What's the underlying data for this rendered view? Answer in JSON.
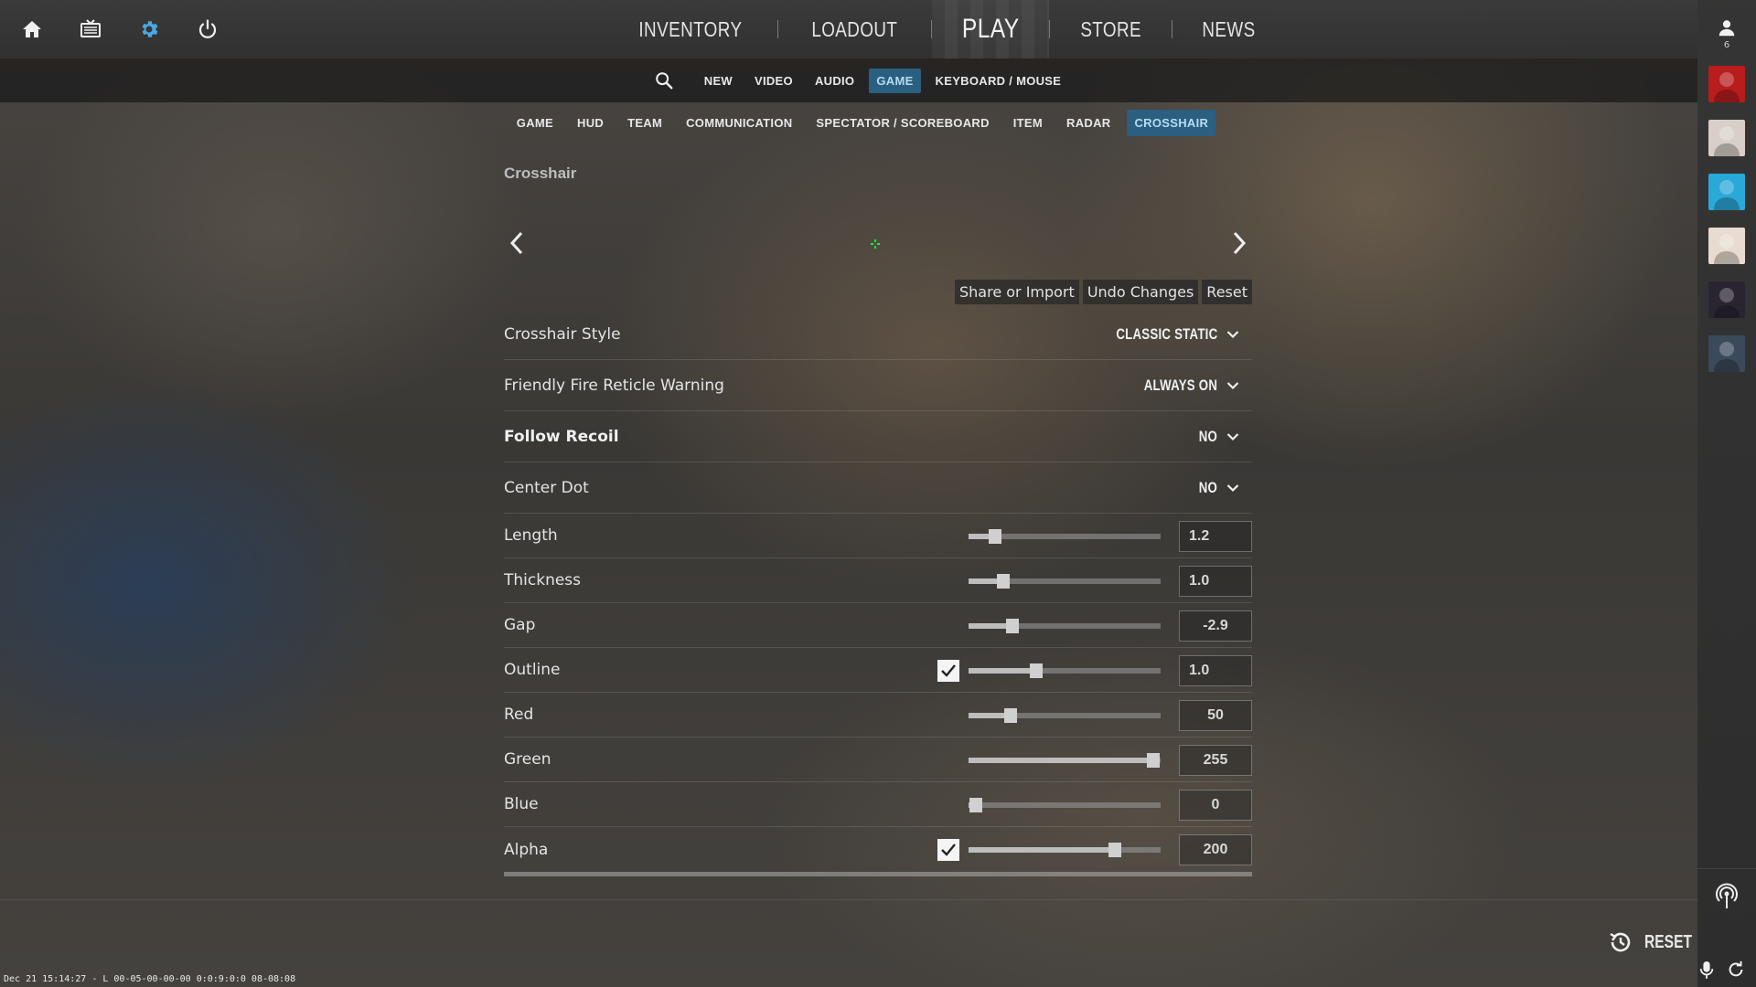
{
  "top_nav": {
    "items": [
      "INVENTORY",
      "LOADOUT",
      "PLAY",
      "STORE",
      "NEWS"
    ]
  },
  "top_icons": [
    "home-icon",
    "tv-icon",
    "gear-icon",
    "power-icon"
  ],
  "settings_tabs": {
    "items": [
      "NEW",
      "VIDEO",
      "AUDIO",
      "GAME",
      "KEYBOARD / MOUSE"
    ],
    "active": "GAME"
  },
  "game_tabs": {
    "items": [
      "GAME",
      "HUD",
      "TEAM",
      "COMMUNICATION",
      "SPECTATOR / SCOREBOARD",
      "ITEM",
      "RADAR",
      "CROSSHAIR"
    ],
    "active": "CROSSHAIR"
  },
  "crosshair": {
    "section_title": "Crosshair",
    "actions": [
      "Share or Import",
      "Undo Changes",
      "Reset"
    ],
    "dropdowns": [
      {
        "label": "Crosshair Style",
        "value": "CLASSIC STATIC",
        "bold": false
      },
      {
        "label": "Friendly Fire Reticle Warning",
        "value": "ALWAYS ON",
        "bold": false
      },
      {
        "label": "Follow Recoil",
        "value": "NO",
        "bold": true
      },
      {
        "label": "Center Dot",
        "value": "NO",
        "bold": false
      }
    ],
    "sliders": [
      {
        "label": "Length",
        "value": "1.2",
        "fraction": 0.14,
        "checkbox": false
      },
      {
        "label": "Thickness",
        "value": "1.0",
        "fraction": 0.18,
        "checkbox": false
      },
      {
        "label": "Gap",
        "value": "-2.9",
        "fraction": 0.23,
        "checkbox": false
      },
      {
        "label": "Outline",
        "value": "1.0",
        "fraction": 0.35,
        "checkbox": true,
        "checked": true
      },
      {
        "label": "Red",
        "value": "50",
        "fraction": 0.22,
        "checkbox": false
      },
      {
        "label": "Green",
        "value": "255",
        "fraction": 0.96,
        "checkbox": false
      },
      {
        "label": "Blue",
        "value": "0",
        "fraction": 0.04,
        "checkbox": false
      },
      {
        "label": "Alpha",
        "value": "200",
        "fraction": 0.76,
        "checkbox": true,
        "checked": true
      }
    ]
  },
  "friends": {
    "count": "6",
    "avatar_colors": [
      "#b81c1c",
      "#d8d0c8",
      "#2aa8d8",
      "#e8dcd0",
      "#2a2430",
      "#3a4a5a"
    ]
  },
  "reset_label": "RESET",
  "status_text": "Dec 21 15:14:27 - L 00-05-00-00-00 0:0:9:0:0 08-08:08",
  "colors": {
    "active_tab_bg": "#2a5f80",
    "active_tab_text": "#b6dcf2",
    "gear_icon": "#4aa8e0",
    "crosshair_green": "#00ff32"
  }
}
